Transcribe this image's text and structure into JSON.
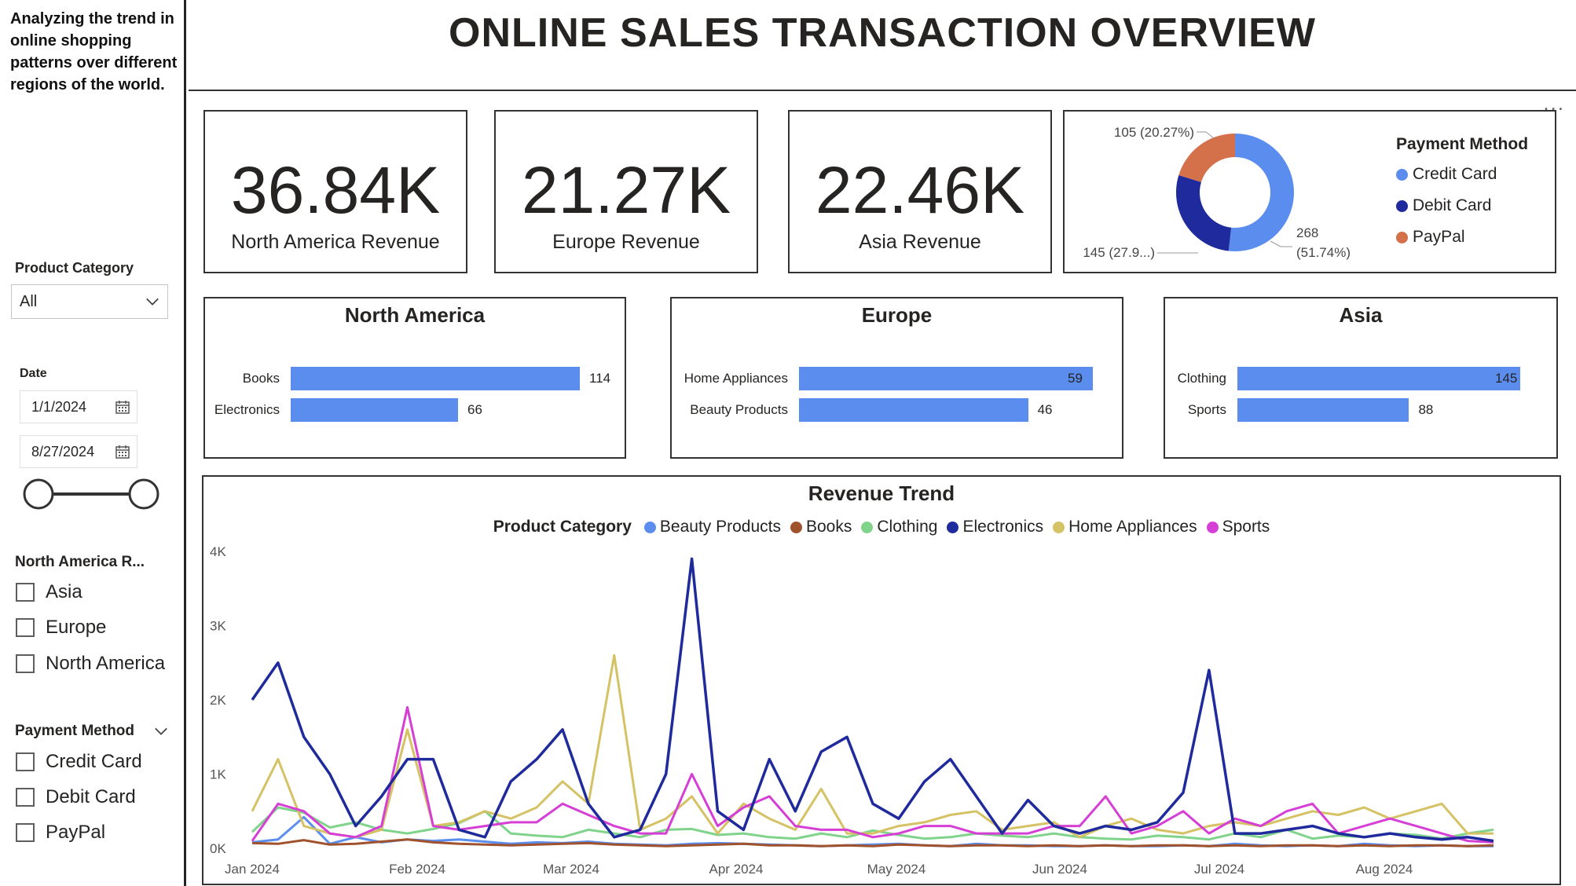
{
  "sidebar": {
    "description": "Analyzing the trend in online shopping patterns over different regions of the world.",
    "product_category": {
      "title": "Product Category",
      "selected": "All"
    },
    "date": {
      "title": "Date",
      "start": "1/1/2024",
      "end": "8/27/2024"
    },
    "region": {
      "title": "North America R...",
      "options": [
        "Asia",
        "Europe",
        "North America"
      ]
    },
    "payment": {
      "title": "Payment Method",
      "options": [
        "Credit Card",
        "Debit Card",
        "PayPal"
      ]
    }
  },
  "header": {
    "title": "ONLINE SALES TRANSACTION OVERVIEW",
    "more": "..."
  },
  "kpis": [
    {
      "value": "36.84K",
      "label": "North America Revenue"
    },
    {
      "value": "21.27K",
      "label": "Europe Revenue"
    },
    {
      "value": "22.46K",
      "label": "Asia Revenue"
    }
  ],
  "colors": {
    "credit": "#5b8def",
    "debit": "#1f2a9c",
    "paypal": "#d4704a",
    "beauty": "#5b8def",
    "books": "#a0522d",
    "clothing": "#7fd38a",
    "electronics": "#1f2a9c",
    "home": "#d4c264",
    "sports": "#d63fd6",
    "bar": "#5b8def"
  },
  "chart_data": [
    {
      "type": "pie",
      "title": "",
      "legend_title": "Payment Method",
      "categories": [
        "Credit Card",
        "Debit Card",
        "PayPal"
      ],
      "values": [
        268,
        145,
        105
      ],
      "labels": [
        "268 (51.74%)",
        "145 (27.9...)",
        "105 (20.27%)"
      ],
      "legend_position": "right"
    },
    {
      "type": "bar",
      "title": "North America",
      "categories": [
        "Books",
        "Electronics"
      ],
      "values": [
        114,
        66
      ]
    },
    {
      "type": "bar",
      "title": "Europe",
      "categories": [
        "Home Appliances",
        "Beauty Products"
      ],
      "values": [
        59,
        46
      ]
    },
    {
      "type": "bar",
      "title": "Asia",
      "categories": [
        "Clothing",
        "Sports"
      ],
      "values": [
        145,
        88
      ]
    },
    {
      "type": "line",
      "title": "Revenue Trend",
      "legend_title": "Product Category",
      "x": [
        "2024-01-01",
        "2024-01-06",
        "2024-01-11",
        "2024-01-16",
        "2024-01-21",
        "2024-01-26",
        "2024-01-31",
        "2024-02-05",
        "2024-02-10",
        "2024-02-15",
        "2024-02-20",
        "2024-02-25",
        "2024-03-01",
        "2024-03-06",
        "2024-03-11",
        "2024-03-16",
        "2024-03-21",
        "2024-03-26",
        "2024-03-31",
        "2024-04-05",
        "2024-04-10",
        "2024-04-15",
        "2024-04-20",
        "2024-04-25",
        "2024-04-30",
        "2024-05-05",
        "2024-05-10",
        "2024-05-15",
        "2024-05-20",
        "2024-05-25",
        "2024-05-30",
        "2024-06-04",
        "2024-06-09",
        "2024-06-14",
        "2024-06-19",
        "2024-06-24",
        "2024-06-29",
        "2024-07-04",
        "2024-07-09",
        "2024-07-14",
        "2024-07-19",
        "2024-07-24",
        "2024-07-29",
        "2024-08-03",
        "2024-08-08",
        "2024-08-13",
        "2024-08-18",
        "2024-08-23",
        "2024-08-27"
      ],
      "x_ticks": [
        "Jan 2024",
        "Feb 2024",
        "Mar 2024",
        "Apr 2024",
        "May 2024",
        "Jun 2024",
        "Jul 2024",
        "Aug 2024"
      ],
      "y_ticks": [
        "0K",
        "1K",
        "2K",
        "3K",
        "4K"
      ],
      "ylim": [
        0,
        4000
      ],
      "series": [
        {
          "name": "Beauty Products",
          "values": [
            80,
            120,
            420,
            60,
            150,
            80,
            120,
            100,
            120,
            90,
            60,
            80,
            70,
            90,
            60,
            50,
            40,
            60,
            70,
            60,
            50,
            40,
            30,
            40,
            50,
            60,
            40,
            30,
            60,
            40,
            40,
            30,
            30,
            40,
            30,
            30,
            40,
            30,
            60,
            40,
            30,
            40,
            30,
            60,
            40,
            30,
            40,
            30,
            30
          ]
        },
        {
          "name": "Books",
          "values": [
            70,
            60,
            110,
            50,
            60,
            90,
            120,
            80,
            60,
            50,
            40,
            50,
            60,
            70,
            50,
            40,
            30,
            40,
            50,
            60,
            40,
            40,
            30,
            40,
            30,
            50,
            40,
            30,
            40,
            40,
            30,
            40,
            30,
            40,
            30,
            40,
            40,
            30,
            40,
            30,
            40,
            40,
            30,
            40,
            30,
            40,
            40,
            30,
            40
          ]
        },
        {
          "name": "Clothing",
          "values": [
            220,
            550,
            480,
            280,
            350,
            250,
            200,
            260,
            340,
            500,
            200,
            170,
            150,
            250,
            200,
            150,
            250,
            260,
            180,
            200,
            150,
            130,
            200,
            150,
            240,
            180,
            130,
            150,
            200,
            170,
            150,
            200,
            150,
            130,
            120,
            170,
            150,
            120,
            200,
            150,
            250,
            130,
            170,
            150,
            200,
            180,
            130,
            200,
            250
          ]
        },
        {
          "name": "Electronics",
          "values": [
            2000,
            2500,
            1500,
            1000,
            300,
            700,
            1200,
            1200,
            250,
            150,
            900,
            1200,
            1600,
            600,
            150,
            250,
            1000,
            3900,
            500,
            250,
            1200,
            500,
            1300,
            1500,
            600,
            400,
            900,
            1200,
            700,
            200,
            650,
            300,
            200,
            300,
            250,
            350,
            750,
            2400,
            200,
            200,
            250,
            300,
            200,
            150,
            200,
            150,
            120,
            150,
            100
          ]
        },
        {
          "name": "Home Appliances",
          "values": [
            500,
            1200,
            300,
            200,
            150,
            250,
            1600,
            300,
            350,
            500,
            400,
            550,
            900,
            600,
            2600,
            250,
            400,
            700,
            200,
            600,
            400,
            250,
            800,
            200,
            200,
            300,
            350,
            450,
            500,
            250,
            300,
            350,
            150,
            300,
            400,
            250,
            200,
            300,
            350,
            300,
            400,
            500,
            450,
            550,
            400,
            500,
            600,
            200,
            200
          ]
        },
        {
          "name": "Sports",
          "values": [
            100,
            600,
            500,
            200,
            150,
            300,
            1900,
            300,
            250,
            300,
            350,
            350,
            600,
            450,
            300,
            200,
            200,
            1000,
            300,
            550,
            700,
            300,
            250,
            250,
            150,
            200,
            300,
            300,
            200,
            200,
            200,
            300,
            300,
            700,
            200,
            300,
            500,
            200,
            400,
            300,
            500,
            600,
            200,
            300,
            400,
            300,
            200,
            100,
            80
          ]
        }
      ],
      "legend_position": "top"
    }
  ]
}
